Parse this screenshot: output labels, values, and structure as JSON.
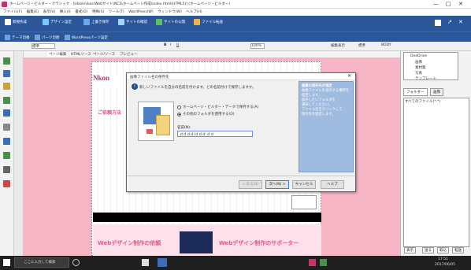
{
  "window": {
    "title": "ホームページ・ビルダー・クラシック - [Ukken\\ikes\\Webサイト\\NCS\\ホームページ作成\\index.html(HTML5)] (ホームページ・ビルダー)",
    "controls": [
      "—",
      "□",
      "✕"
    ]
  },
  "menubar": {
    "items": [
      "ファイル(F)",
      "編集(E)",
      "表示(V)",
      "挿入(I)",
      "書式(O)",
      "特殊(S)",
      "ツール(T)",
      "WordPress(W)",
      "ウィンドウ(W)",
      "ヘルプ(H)"
    ]
  },
  "ribbon": {
    "items": [
      "新規作成",
      "デザイン設定",
      "上書き保存",
      "サイトの確認",
      "サイトの公開",
      "ファイル転送"
    ]
  },
  "ribbon2": {
    "items": [
      "テーマ切替",
      "パーツ切替",
      "WordPressパーツ設定"
    ]
  },
  "toolbar": {
    "font_size": "標準",
    "format_items": [
      "B",
      "I",
      "U"
    ],
    "zoom": "100%",
    "right_items": [
      "編集表示",
      "標準",
      "BODY"
    ]
  },
  "editor_tabs": [
    "ページ編集",
    "HTMLソース",
    "ページ/ソース",
    "プレビュー"
  ],
  "page": {
    "logo_text": "Nkon",
    "banner1": "Webデザイン制作の依頼",
    "banner2": "Webデザイン制作のサポーター",
    "left_pink_text": "ご依頼方法"
  },
  "dialog": {
    "title": "画像ファイル名の保存先",
    "message": "新しいファイルを自分の名前を付けます。どの名前付けで保存しますか。",
    "options": [
      "ホームページ・ビルダー・データで保存する(A)",
      "その他のフォルダを使用する(O)"
    ],
    "filename_label": "名前(N):",
    "filename_value": "ｄｄｄｄ/ｄｄｄ.ｄｄ",
    "info_title": "画像の保存先の指定",
    "info_lines": [
      "画像ファイルを保存する場所を指定します。",
      "保存したいフォルダを",
      "選択してください。",
      "ファイル名をクリックして",
      "保存先を指定します。"
    ],
    "buttons": [
      "< 戻る(B)",
      "次へ(N) >",
      "キャンセル",
      "ヘルプ"
    ]
  },
  "right_panel": {
    "tree_items": [
      "OneDrive",
      "画像",
      "素材集",
      "写真",
      "テンプレート"
    ],
    "tabs": [
      "フォルダー",
      "画像"
    ],
    "file_list_header": "すべてのファイル(*.*)",
    "bottom_buttons": [
      "表示",
      "送る",
      "取込",
      "転送"
    ]
  },
  "taskbar": {
    "search_placeholder": "ここに入力して検索",
    "clock": "17:51",
    "date": "2017/06/05"
  }
}
